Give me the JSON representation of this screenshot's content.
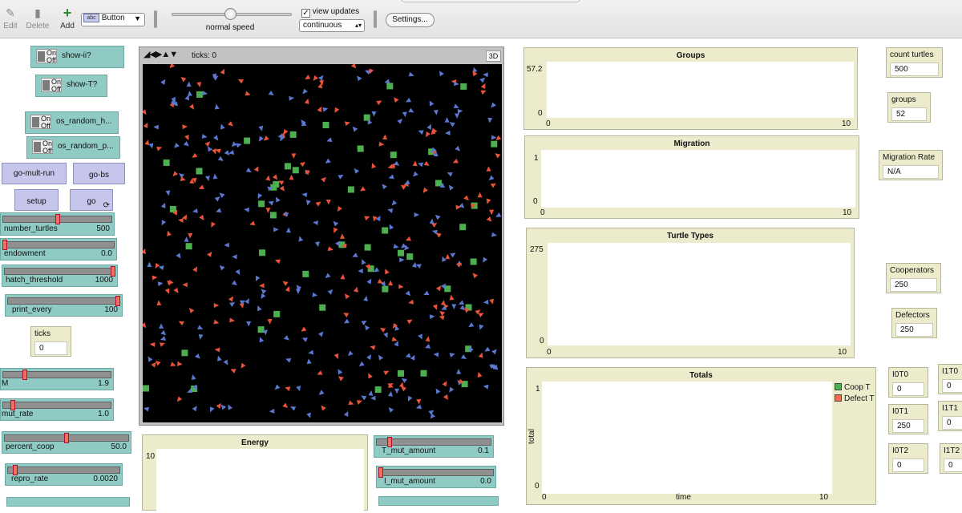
{
  "toolbar": {
    "edit": "Edit",
    "delete": "Delete",
    "add": "Add",
    "widget_type": "Button",
    "widget_icon_text": "abc",
    "speed_label": "normal speed",
    "view_updates_label": "view updates",
    "update_mode": "continuous",
    "settings": "Settings..."
  },
  "switches": [
    {
      "on": "On",
      "off": "Off",
      "label": "show-ii?"
    },
    {
      "on": "On",
      "off": "Off",
      "label": "show-T?"
    },
    {
      "on": "On",
      "off": "Off",
      "label": "os_random_h..."
    },
    {
      "on": "On",
      "off": "Off",
      "label": "os_random_p..."
    }
  ],
  "buttons": {
    "go_mult_run": "go-mult-run",
    "go_bs": "go-bs",
    "setup": "setup",
    "go": "go",
    "forever_icon": "forever-icon"
  },
  "sliders": [
    {
      "name": "number_turtles",
      "value": "500",
      "fraction": 0.5
    },
    {
      "name": "endowment",
      "value": "0.0",
      "fraction": 0.0
    },
    {
      "name": "hatch_threshold",
      "value": "1000",
      "fraction": 1.0
    },
    {
      "name": "print_every",
      "value": "100",
      "fraction": 1.0
    },
    {
      "name": "M",
      "value": "1.9",
      "fraction": 0.19
    },
    {
      "name": "mut_rate",
      "value": "1.0",
      "fraction": 0.08
    },
    {
      "name": "percent_coop",
      "value": "50.0",
      "fraction": 0.5
    },
    {
      "name": "repro_rate",
      "value": "0.0020",
      "fraction": 0.05
    },
    {
      "name": "T_mut_amount",
      "value": "0.1",
      "fraction": 0.1
    },
    {
      "name": "I_mut_amount",
      "value": "0.0",
      "fraction": 0.0
    }
  ],
  "ticks_monitor": {
    "label": "ticks",
    "value": "0"
  },
  "view": {
    "ticks_label": "ticks: 0",
    "three_d": "3D",
    "arrows_glyph": "◢◀▶▲▼"
  },
  "monitors": {
    "count_turtles": {
      "label": "count turtles",
      "value": "500"
    },
    "groups": {
      "label": "groups",
      "value": "52"
    },
    "migration_rate": {
      "label": "Migration Rate",
      "value": "N/A"
    },
    "cooperators": {
      "label": "Cooperators",
      "value": "250"
    },
    "defectors": {
      "label": "Defectors",
      "value": "250"
    },
    "i0t0": {
      "label": "I0T0",
      "value": "0"
    },
    "i0t1": {
      "label": "I0T1",
      "value": "250"
    },
    "i0t2": {
      "label": "I0T2",
      "value": "0"
    },
    "i1t0": {
      "label": "I1T0",
      "value": "0"
    },
    "i1t1": {
      "label": "I1T1",
      "value": "0"
    },
    "i1t2": {
      "label": "I1T2",
      "value": "0"
    }
  },
  "plots": {
    "groups": {
      "title": "Groups",
      "ymax": "57.2",
      "ymin": "0",
      "xmin": "0",
      "xmax": "10"
    },
    "migration": {
      "title": "Migration",
      "ymax": "1",
      "ymin": "0",
      "xmin": "0",
      "xmax": "10"
    },
    "turtle_types": {
      "title": "Turtle Types",
      "ymax": "275",
      "ymin": "0",
      "xmin": "0",
      "xmax": "10"
    },
    "totals": {
      "title": "Totals",
      "ymax": "1",
      "ymin": "0",
      "xmin": "0",
      "xmax": "10",
      "xlabel": "time",
      "ylabel": "total",
      "legend": [
        {
          "name": "Coop T",
          "color": "#4caf50"
        },
        {
          "name": "Defect T",
          "color": "#f07050"
        }
      ]
    },
    "energy": {
      "title": "Energy",
      "ymax": "10"
    }
  },
  "colors": {
    "widget_teal": "#8fcac4",
    "button_lavender": "#c6c6ec",
    "monitor_beige": "#ececcd",
    "world_bg": "#000000",
    "agent_red": "#e8533a",
    "agent_blue": "#5a78d0",
    "patch_green": "#4caf50"
  }
}
